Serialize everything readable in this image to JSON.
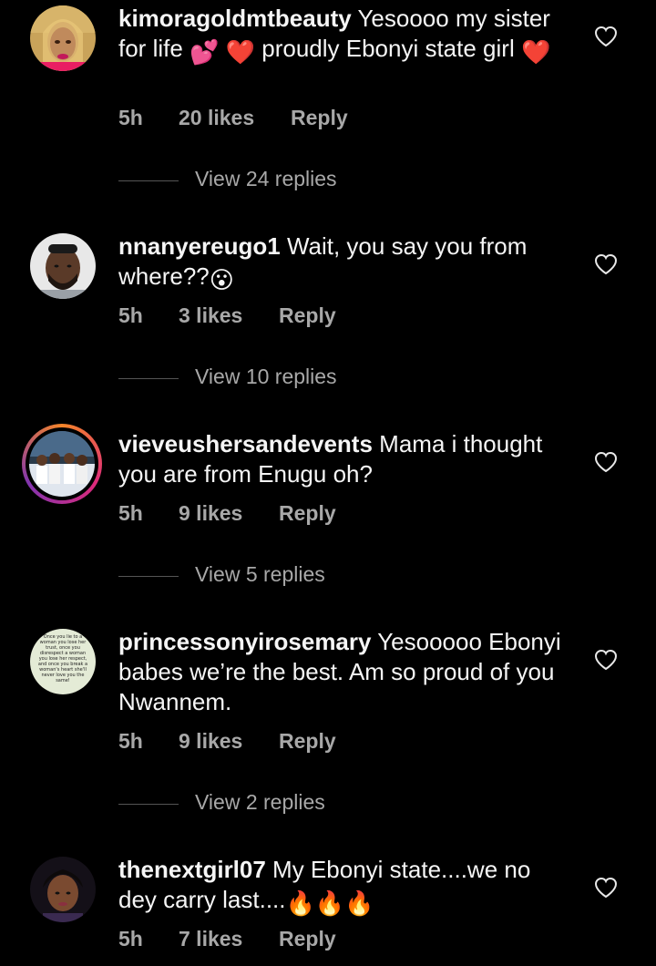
{
  "comments": [
    {
      "username": "kimoragoldmtbeauty",
      "text_a": " Yesoooo  my sister for life ",
      "emoji_a": "💕",
      "text_b": " ",
      "emoji_b": "❤️",
      "text_c": " proudly Ebonyi state girl ",
      "emoji_c": "❤️",
      "time": "5h",
      "likes": "20 likes",
      "reply": "Reply",
      "view_replies": "View 24 replies"
    },
    {
      "username": "nnanyereugo1",
      "text_a": " Wait, you say you from where??",
      "emoji_a": "😮",
      "time": "5h",
      "likes": "3 likes",
      "reply": "Reply",
      "view_replies": "View 10 replies"
    },
    {
      "username": "vieveushersandevents",
      "text_a": " Mama i thought you are from Enugu oh?",
      "time": "5h",
      "likes": "9 likes",
      "reply": "Reply",
      "view_replies": "View 5 replies"
    },
    {
      "username": "princessonyirosemary",
      "text_a": " Yesooooo Ebonyi babes we’re the best. Am so proud of you Nwannem.",
      "avatar_text": "Once you lie to a woman you lose her trust, once you disrespect a woman you lose her respect, and once you break a woman's heart she'll never love you the same!",
      "time": "5h",
      "likes": "9 likes",
      "reply": "Reply",
      "view_replies": "View 2 replies"
    },
    {
      "username": "thenextgirl07",
      "text_a": " My Ebonyi state....we no dey carry last....",
      "emoji_a": "🔥🔥🔥",
      "time": "5h",
      "likes": "7 likes",
      "reply": "Reply"
    }
  ],
  "icons": {
    "like": "heart-outline-icon"
  },
  "colors": {
    "background": "#000000",
    "text": "#f5f5f5",
    "muted": "#a8a8a8",
    "heart": "#e41e3f"
  }
}
